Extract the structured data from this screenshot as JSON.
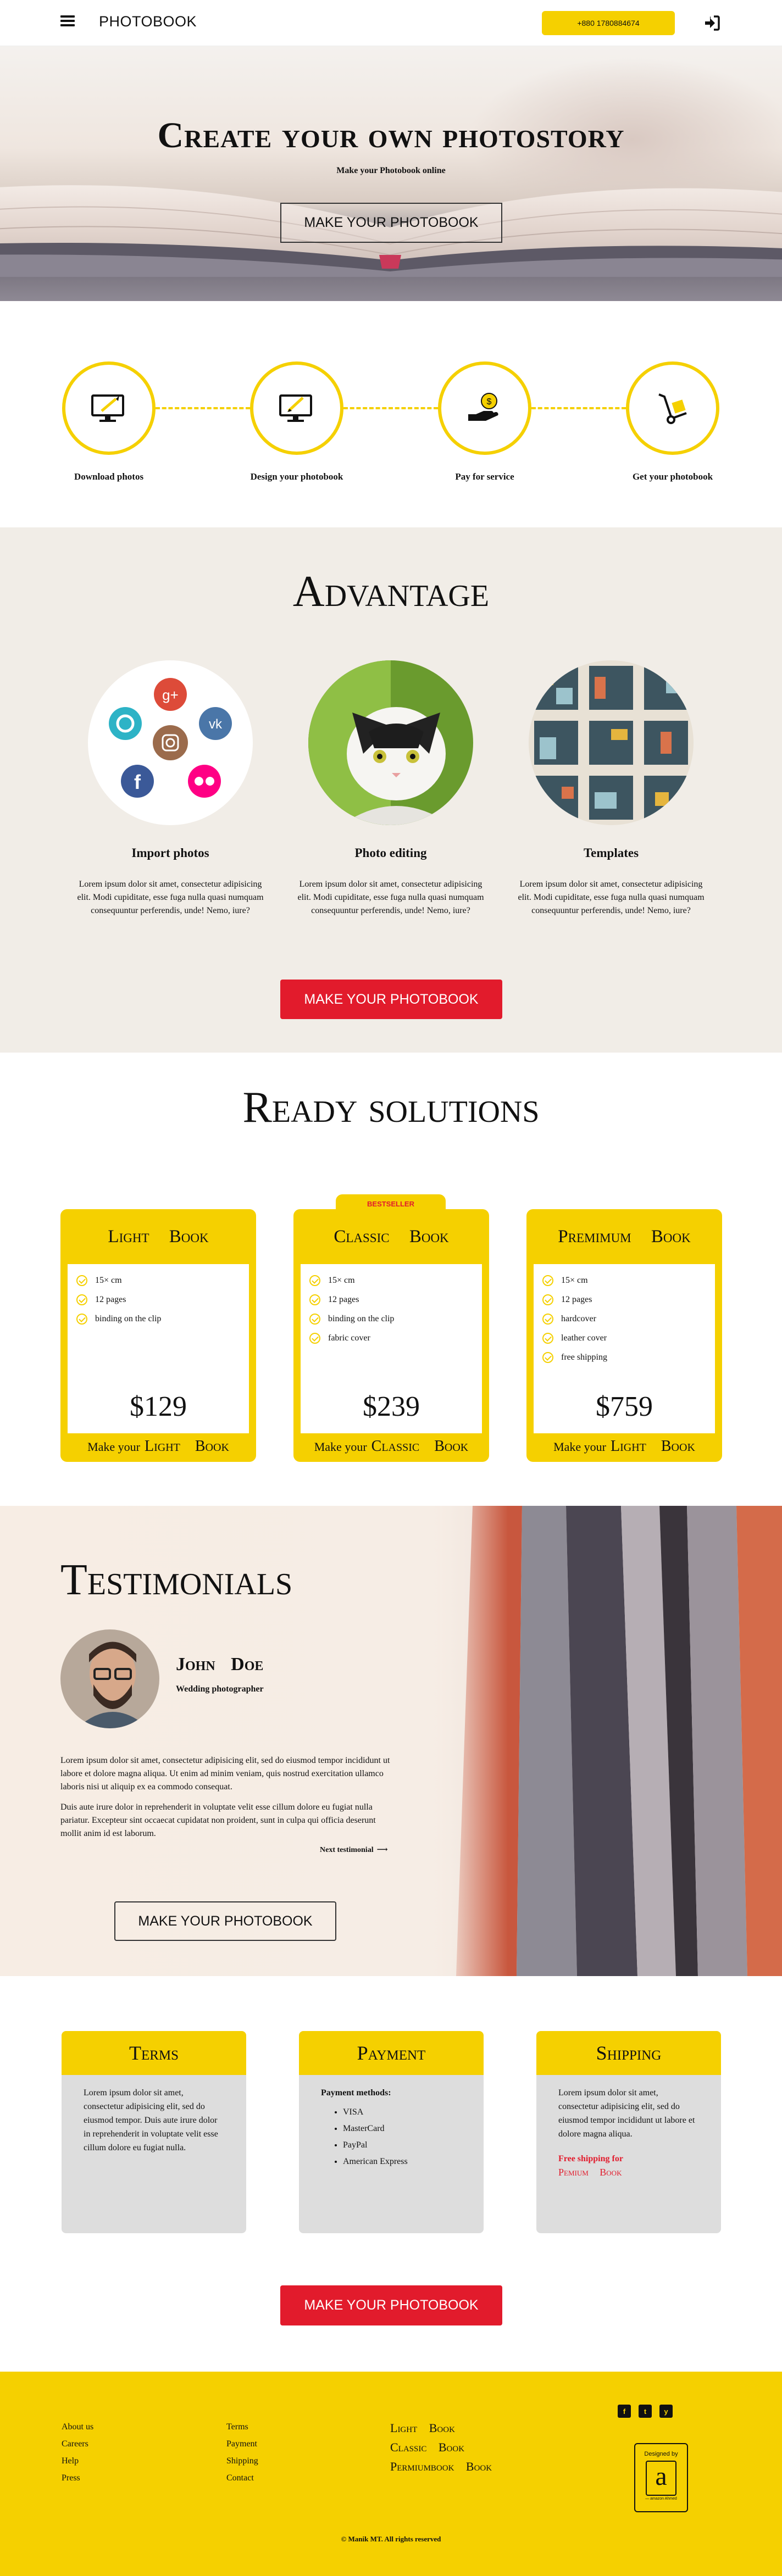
{
  "header": {
    "logo": "PHOTOBOOK",
    "phone": "+880 1780884674",
    "menu_icon": "hamburger-icon",
    "login_icon": "sign-in-icon"
  },
  "hero": {
    "title": "Create your own photostory",
    "subtitle": "Make your Photobook online",
    "button": "MAKE YOUR PHOTOBOOK"
  },
  "steps": [
    {
      "label": "Download photos",
      "icon": "monitor-upload-icon"
    },
    {
      "label": "Design your photobook",
      "icon": "monitor-design-icon"
    },
    {
      "label": "Pay for service",
      "icon": "hand-coin-icon"
    },
    {
      "label": "Get your photobook",
      "icon": "hand-truck-icon"
    }
  ],
  "advantage": {
    "title": "Advantage",
    "items": [
      {
        "title": "Import photos",
        "text": "Lorem ipsum dolor sit amet, consectetur adipisicing elit. Modi cupiditate, esse fuga nulla quasi numquam consequuntur perferendis, unde! Nemo, iure?"
      },
      {
        "title": "Photo editing",
        "text": "Lorem ipsum dolor sit amet, consectetur adipisicing elit. Modi cupiditate, esse fuga nulla quasi numquam consequuntur perferendis, unde! Nemo, iure?"
      },
      {
        "title": "Templates",
        "text": "Lorem ipsum dolor sit amet, consectetur adipisicing elit. Modi cupiditate, esse fuga nulla quasi numquam consequuntur perferendis, unde! Nemo, iure?"
      }
    ],
    "button": "MAKE YOUR PHOTOBOOK"
  },
  "ready": {
    "title": "Ready solutions",
    "badge": "BESTSELLER",
    "cards": [
      {
        "title": "Light Book",
        "features": [
          "15× cm",
          "12 pages",
          "binding on the clip"
        ],
        "price": "$129",
        "make": "Make your",
        "make_name": "Light Book"
      },
      {
        "title": "Classic Book",
        "features": [
          "15× cm",
          "12 pages",
          "binding on the clip",
          "fabric cover"
        ],
        "price": "$239",
        "make": "Make your",
        "make_name": "Classic Book"
      },
      {
        "title": "Premimum Book",
        "features": [
          "15× cm",
          "12 pages",
          "hardcover",
          "leather cover",
          "free shipping"
        ],
        "price": "$759",
        "make": "Make your",
        "make_name": "Light Book"
      }
    ]
  },
  "testimonials": {
    "title": "Testimonials",
    "name": "John Doe",
    "role": "Wedding photographer",
    "p1": "Lorem ipsum dolor sit amet, consectetur adipisicing elit, sed do eiusmod tempor incididunt ut labore et dolore magna aliqua. Ut enim ad minim veniam, quis nostrud exercitation ullamco laboris nisi ut aliquip ex ea commodo consequat.",
    "p2": "Duis aute irure dolor in reprehenderit in voluptate velit esse cillum dolore eu fugiat nulla pariatur. Excepteur sint occaecat cupidatat non proident, sunt in culpa qui officia deserunt mollit anim id est laborum.",
    "next": "Next testimonial",
    "button": "MAKE YOUR PHOTOBOOK"
  },
  "info": {
    "terms": {
      "title": "Terms",
      "text": "Lorem ipsum dolor sit amet, consectetur adipisicing elit, sed do eiusmod tempor. Duis aute irure dolor in reprehenderit in voluptate velit esse cillum dolore eu fugiat nulla."
    },
    "payment": {
      "title": "Payment",
      "label": "Payment methods:",
      "methods": [
        "VISA",
        "MasterCard",
        "PayPal",
        "American Express"
      ]
    },
    "shipping": {
      "title": "Shipping",
      "text": "Lorem ipsum dolor sit amet, consectetur adipisicing elit, sed do eiusmod tempor incididunt ut labore et dolore magna aliqua.",
      "free": "Free shipping for",
      "book": "Pemium Book"
    },
    "button": "MAKE YOUR PHOTOBOOK"
  },
  "footer": {
    "col1": [
      "About us",
      "Careers",
      "Help",
      "Press"
    ],
    "col2": [
      "Terms",
      "Payment",
      "Shipping",
      "Contact"
    ],
    "books": [
      "Light Book",
      "Classic Book",
      "Permiumbook Book"
    ],
    "social": [
      "f",
      "t",
      "y"
    ],
    "designed_by": "Designed by",
    "designed_letter": "a",
    "designed_small": "— amazon Ahmed",
    "copyright": "© Manik MT. All rights reserved"
  },
  "colors": {
    "accent": "#f5d000",
    "red": "#e21b2c",
    "beige": "#f1ede7"
  }
}
